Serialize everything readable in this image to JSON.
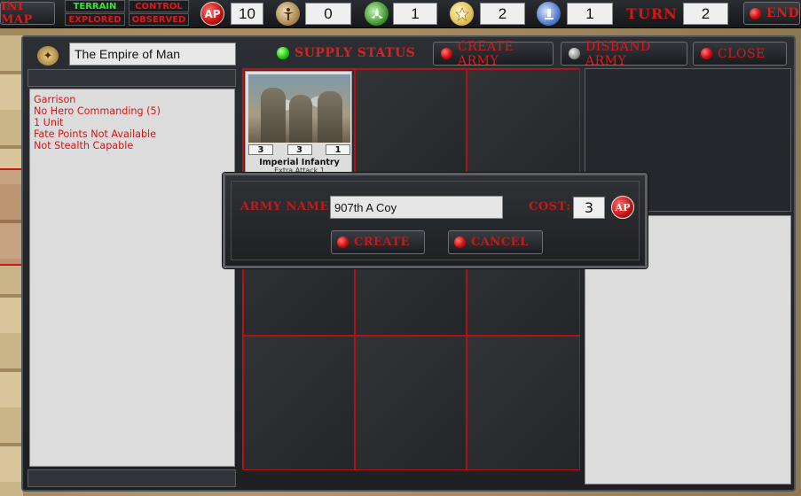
{
  "top_bar": {
    "mini_map_label": "INI MAP",
    "modes": [
      {
        "label": "TERRAIN",
        "color": "#2ee82e"
      },
      {
        "label": "CONTROL",
        "color": "#e01818"
      },
      {
        "label": "EXPLORED",
        "color": "#e01818"
      },
      {
        "label": "OBSERVED",
        "color": "#e01818"
      }
    ],
    "resources": [
      {
        "icon": "ap-icon",
        "value": "10"
      },
      {
        "icon": "population-icon",
        "value": "0"
      },
      {
        "icon": "hazard-icon",
        "value": "1"
      },
      {
        "icon": "fate-star-icon",
        "value": "2"
      },
      {
        "icon": "research-icon",
        "value": "1"
      }
    ],
    "ap_icon_text": "AP",
    "turn_label": "TURN",
    "turn_value": "2",
    "end_label": "END"
  },
  "army_window": {
    "faction_name": "The Empire of Man",
    "supply_status": "SUPPLY STATUS",
    "create_army": "CREATE ARMY",
    "disband_army": "DISBAND ARMY",
    "close": "CLOSE",
    "info_lines": [
      "Garrison",
      "No Hero Commanding (5)",
      "1 Unit",
      "Fate Points Not Available",
      "Not Stealth Capable"
    ],
    "unit_card": {
      "stats": [
        "3",
        "3",
        "1"
      ],
      "name": "Imperial Infantry",
      "subtitle": "Extra Attack 1"
    }
  },
  "dialog": {
    "army_name_label": "ARMY NAME:",
    "army_name_value": "907th A Coy",
    "cost_label": "COST:",
    "cost_value": "3",
    "ap_badge": "AP",
    "create_label": "CREATE",
    "cancel_label": "CANCEL"
  }
}
